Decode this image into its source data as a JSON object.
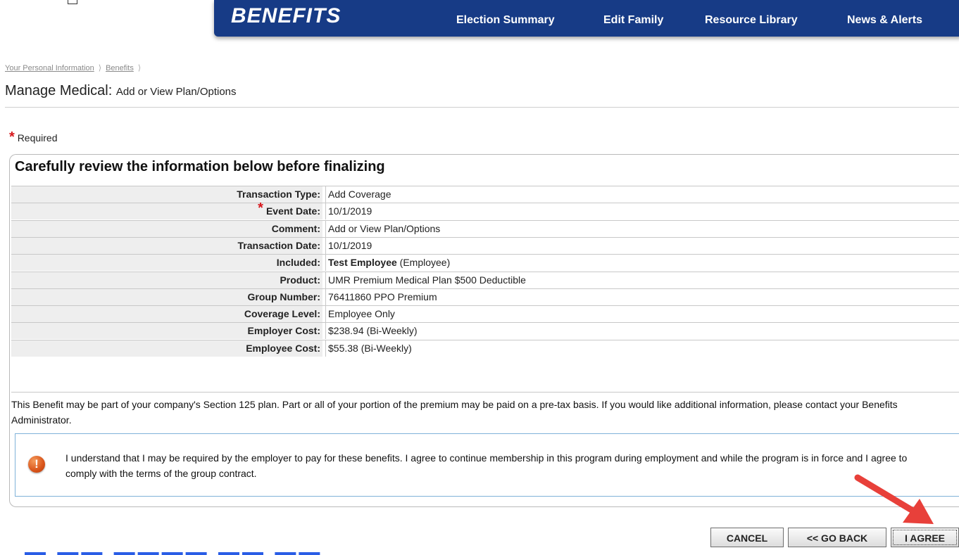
{
  "banner": {
    "title": "BENEFITS",
    "nav": [
      "Election Summary",
      "Edit Family",
      "Resource Library",
      "News & Alerts"
    ]
  },
  "breadcrumb": [
    "Your Personal Information",
    "Benefits"
  ],
  "page": {
    "title": "Manage Medical:",
    "subtitle": "Add or View Plan/Options"
  },
  "required_label": "Required",
  "review": {
    "heading": "Carefully review the information below before finalizing",
    "rows": [
      {
        "label": "Transaction Type:",
        "value": "Add Coverage",
        "required": false
      },
      {
        "label": "Event Date:",
        "value": "10/1/2019",
        "required": true
      },
      {
        "label": "Comment:",
        "value": "Add or View Plan/Options",
        "required": false
      },
      {
        "label": "Transaction Date:",
        "value": "10/1/2019",
        "required": false
      },
      {
        "label": "Included:",
        "value_bold": "Test Employee",
        "value": " (Employee)",
        "required": false
      },
      {
        "label": "Product:",
        "value": "UMR Premium Medical Plan $500 Deductible",
        "required": false
      },
      {
        "label": "Group Number:",
        "value": "76411860 PPO Premium",
        "required": false
      },
      {
        "label": "Coverage Level:",
        "value": "Employee Only",
        "required": false
      },
      {
        "label": "Employer Cost:",
        "value": "$238.94 (Bi-Weekly)",
        "required": false
      },
      {
        "label": "Employee Cost:",
        "value": "$55.38 (Bi-Weekly)",
        "required": false
      }
    ],
    "disclaimer": "This Benefit may be part of your company's Section 125 plan. Part or all of your portion of the premium may be paid on a pre-tax basis. If you would like additional information, please contact your Benefits Administrator.",
    "agreement": "I understand that I may be required by the employer to pay for these benefits. I agree to continue membership in this program during employment and while the program is in force and I agree to comply with the terms of the group contract.",
    "warning_icon": "!"
  },
  "buttons": {
    "cancel": "CANCEL",
    "back": "<< GO BACK",
    "agree": "I AGREE"
  },
  "colors": {
    "banner": "#173b86",
    "required_star": "#d6161b",
    "arrow": "#e8403a"
  }
}
